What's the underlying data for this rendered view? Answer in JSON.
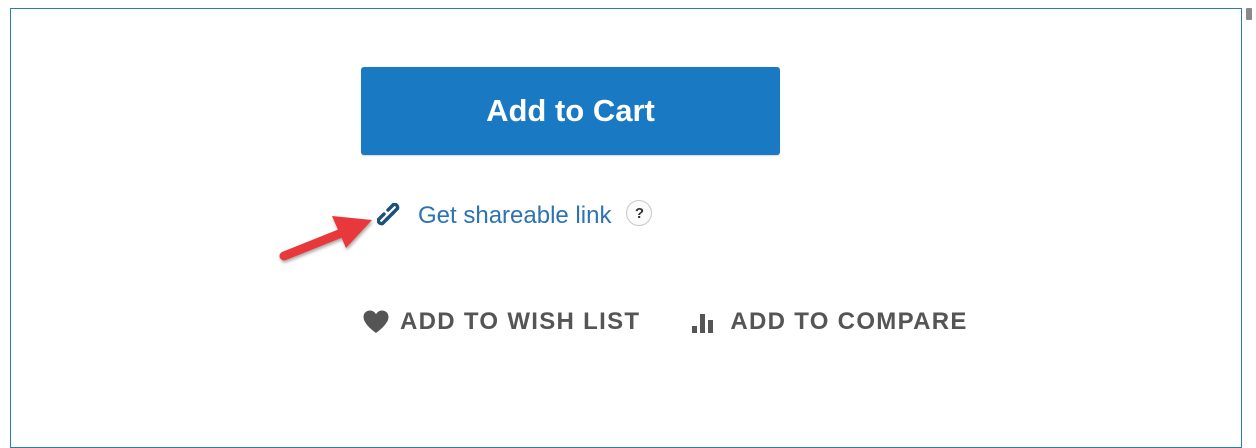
{
  "product_actions": {
    "add_to_cart_label": "Add to Cart",
    "shareable_link_label": "Get shareable link",
    "help_label": "?",
    "wish_list_label": "ADD TO WISH LIST",
    "compare_label": "ADD TO COMPARE"
  },
  "icons": {
    "link": "link-icon",
    "help": "question-circle-icon",
    "wish": "heart-icon",
    "compare": "bar-chart-icon",
    "annotation": "red-arrow"
  },
  "colors": {
    "primary_button": "#1979c3",
    "link_text": "#2d72b4",
    "action_text": "#555555",
    "frame_border": "#2e79b9",
    "annotation_arrow": "#e8373a"
  }
}
